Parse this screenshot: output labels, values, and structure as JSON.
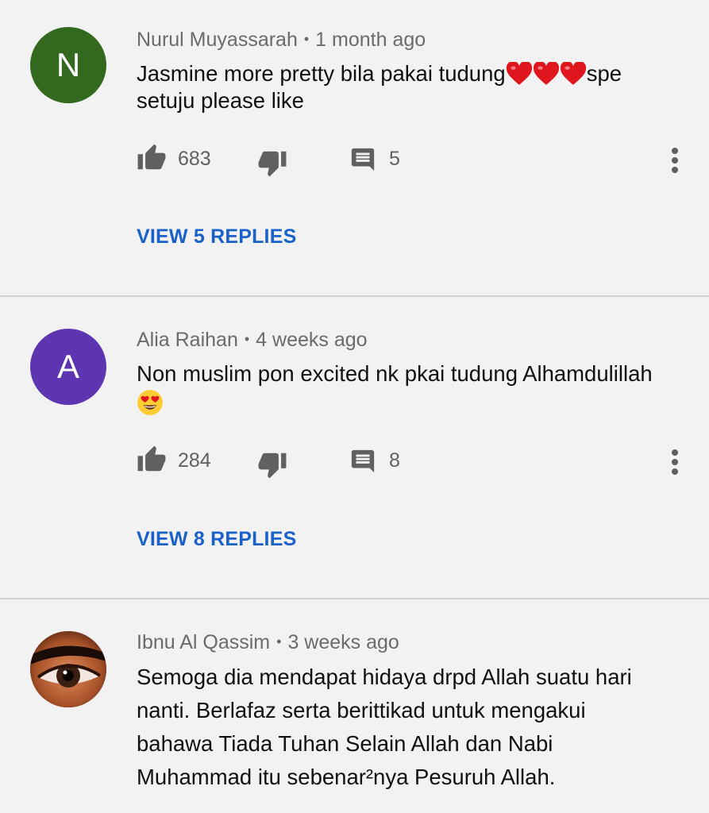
{
  "comments": [
    {
      "avatar_letter": "N",
      "avatar_color": "#33691e",
      "author": "Nurul Muyassarah",
      "time": "1 month ago",
      "text_before": "Jasmine more pretty bila pakai tudung",
      "text_after": "spe setuju please like",
      "emojis": [
        "red-heart",
        "red-heart",
        "red-heart"
      ],
      "likes": "683",
      "replies_count": "5",
      "view_replies": "VIEW 5 REPLIES"
    },
    {
      "avatar_letter": "A",
      "avatar_color": "#5e35b1",
      "author": "Alia Raihan",
      "time": "4 weeks ago",
      "text": "Non muslim pon excited nk pkai tudung Alhamdulillah",
      "emojis": [
        "heart-eyes-face"
      ],
      "likes": "284",
      "replies_count": "8",
      "view_replies": "VIEW 8 REPLIES"
    },
    {
      "avatar_image": "eye-closeup-photo",
      "author": "Ibnu Al Qassim",
      "time": "3 weeks ago",
      "text_lines": [
        "Semoga dia mendapat hidaya drpd Allah suatu hari",
        "nanti. Berlafaz serta berittikad untuk mengakui",
        "bahawa Tiada Tuhan Selain Allah dan Nabi",
        "Muhammad itu sebenar²nya Pesuruh Allah."
      ]
    }
  ],
  "colors": {
    "background": "#f2f2f2",
    "link_blue": "#1a62c9",
    "icon_gray": "#606060",
    "divider": "#d2d2d2"
  }
}
